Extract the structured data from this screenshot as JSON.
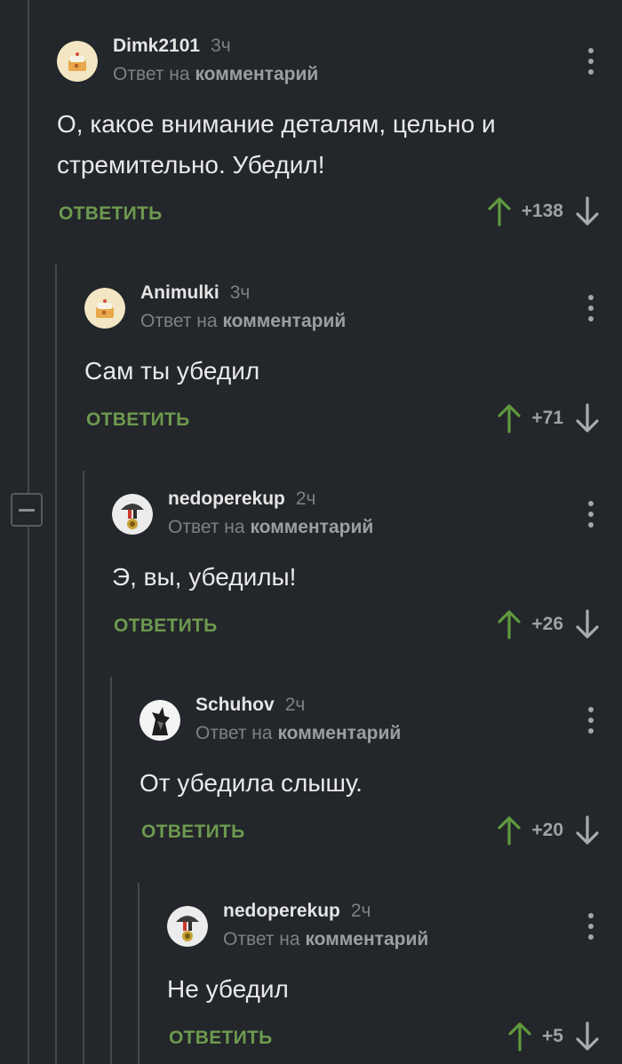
{
  "comments": [
    {
      "author": "Dimk2101",
      "time": "3ч",
      "reply_prefix": "Ответ на",
      "reply_target": "комментарий",
      "text": "О, какое внимание деталям, цельно и стремительно. Убедил!",
      "reply_label": "ОТВЕТИТЬ",
      "score": "+138",
      "avatar": "cake-avatar"
    },
    {
      "author": "Animulki",
      "time": "3ч",
      "reply_prefix": "Ответ на",
      "reply_target": "комментарий",
      "text": "Сам ты убедил",
      "reply_label": "ОТВЕТИТЬ",
      "score": "+71",
      "avatar": "cake-avatar"
    },
    {
      "author": "nedoperekup",
      "time": "2ч",
      "reply_prefix": "Ответ на",
      "reply_target": "комментарий",
      "text": "Э, вы, убедилы!",
      "reply_label": "ОТВЕТИТЬ",
      "score": "+26",
      "avatar": "medal-avatar"
    },
    {
      "author": "Schuhov",
      "time": "2ч",
      "reply_prefix": "Ответ на",
      "reply_target": "комментарий",
      "text": "От убедила слышу.",
      "reply_label": "ОТВЕТИТЬ",
      "score": "+20",
      "avatar": "sketch-avatar"
    },
    {
      "author": "nedoperekup",
      "time": "2ч",
      "reply_prefix": "Ответ на",
      "reply_target": "комментарий",
      "text": "Не убедил",
      "reply_label": "ОТВЕТИТЬ",
      "score": "+5",
      "avatar": "medal-avatar"
    }
  ],
  "colors": {
    "background": "#23262a",
    "reply_green": "#6d9a4f",
    "upvote_green": "#5f9a3e",
    "muted": "#7e8184"
  }
}
